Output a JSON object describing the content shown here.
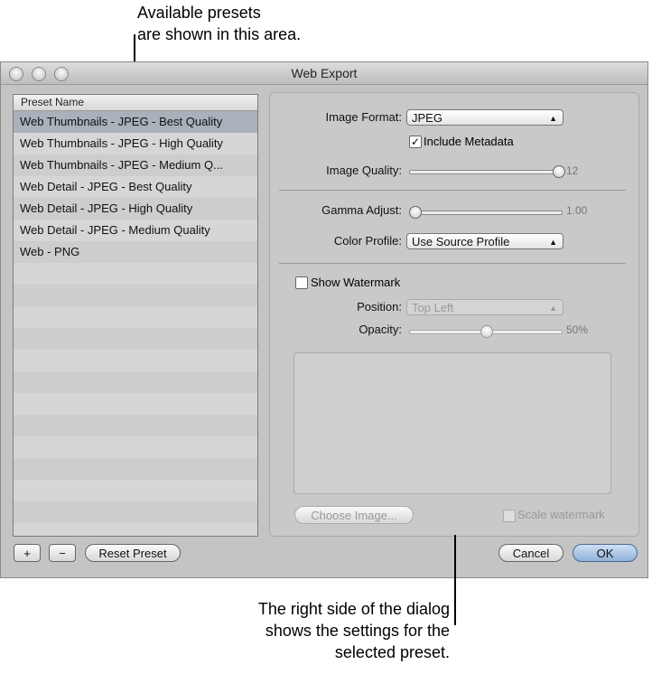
{
  "callouts": {
    "top_line1": "Available presets",
    "top_line2": "are shown in this area.",
    "bottom_line1": "The right side of the dialog",
    "bottom_line2": "shows the settings for the",
    "bottom_line3": "selected preset."
  },
  "window": {
    "title": "Web Export"
  },
  "list": {
    "header": "Preset Name",
    "items": [
      "Web Thumbnails - JPEG - Best Quality",
      "Web Thumbnails - JPEG - High Quality",
      "Web Thumbnails - JPEG - Medium Q...",
      "Web Detail - JPEG - Best Quality",
      "Web Detail - JPEG - High Quality",
      "Web Detail - JPEG - Medium Quality",
      "Web - PNG"
    ],
    "selected": 0
  },
  "settings": {
    "image_format_label": "Image Format:",
    "image_format": "JPEG",
    "include_metadata_label": "Include Metadata",
    "include_metadata": true,
    "image_quality_label": "Image Quality:",
    "image_quality": "12",
    "image_quality_fraction": 1.0,
    "gamma_label": "Gamma Adjust:",
    "gamma": "1.00",
    "gamma_fraction": 0.0,
    "color_profile_label": "Color Profile:",
    "color_profile": "Use Source Profile",
    "show_watermark_label": "Show Watermark",
    "show_watermark": false,
    "position_label": "Position:",
    "position": "Top Left",
    "opacity_label": "Opacity:",
    "opacity": "50%",
    "opacity_fraction": 0.5,
    "choose_image": "Choose Image...",
    "scale_watermark": "Scale watermark"
  },
  "buttons": {
    "add": "+",
    "remove": "−",
    "reset": "Reset Preset",
    "cancel": "Cancel",
    "ok": "OK"
  }
}
